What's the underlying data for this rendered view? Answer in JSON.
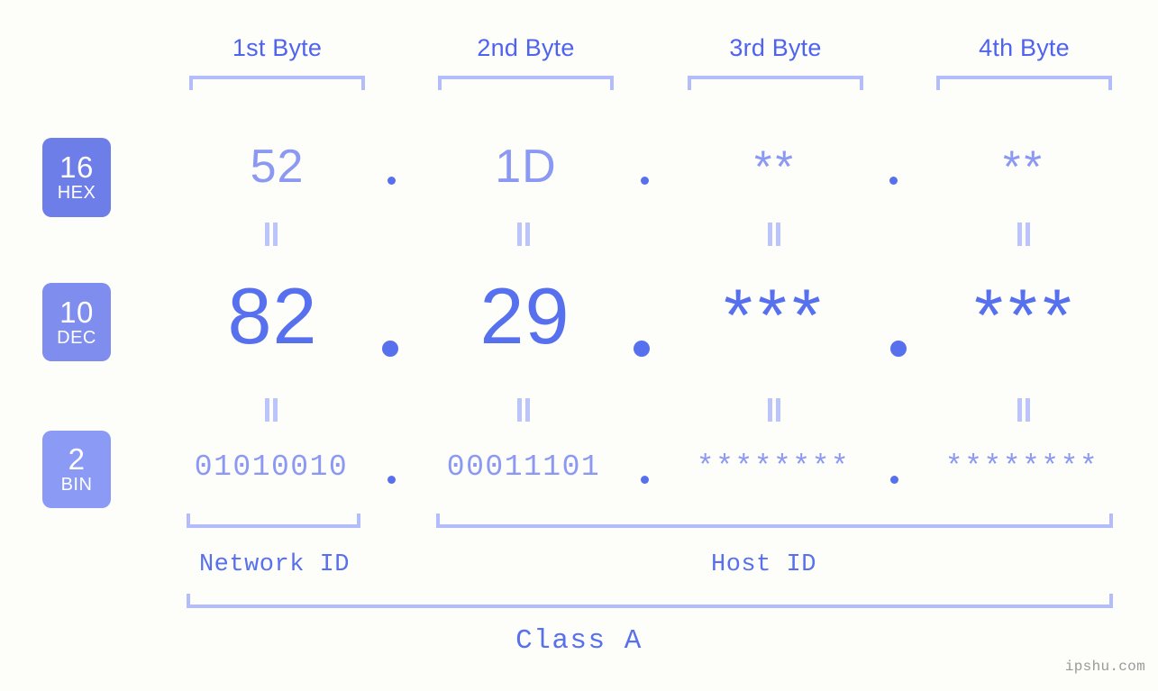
{
  "background_color": "#fdfdfa",
  "accent_color": "#5770ee",
  "accent_light_color": "#8b99f3",
  "bracket_color": "#b4bdfb",
  "byte_headers": [
    {
      "label": "1st Byte"
    },
    {
      "label": "2nd Byte"
    },
    {
      "label": "3rd Byte"
    },
    {
      "label": "4th Byte"
    }
  ],
  "rows": [
    {
      "badge_number": "16",
      "badge_abbr": "HEX",
      "badge_color": "#6e7ee8",
      "values": [
        "52",
        "1D",
        "**",
        "**"
      ],
      "separators": [
        ".",
        ".",
        "."
      ]
    },
    {
      "badge_number": "10",
      "badge_abbr": "DEC",
      "badge_color": "#7e8dee",
      "values": [
        "82",
        "29",
        "***",
        "***"
      ],
      "separators": [
        ".",
        ".",
        "."
      ]
    },
    {
      "badge_number": "2",
      "badge_abbr": "BIN",
      "badge_color": "#8b9bf5",
      "values": [
        "01010010",
        "00011101",
        "********",
        "********"
      ],
      "separators": [
        ".",
        ".",
        "."
      ]
    }
  ],
  "equals_glyph": "=",
  "id_segments": [
    {
      "label": "Network ID"
    },
    {
      "label": "Host ID"
    }
  ],
  "class_label": "Class A",
  "watermark": "ipshu.com"
}
